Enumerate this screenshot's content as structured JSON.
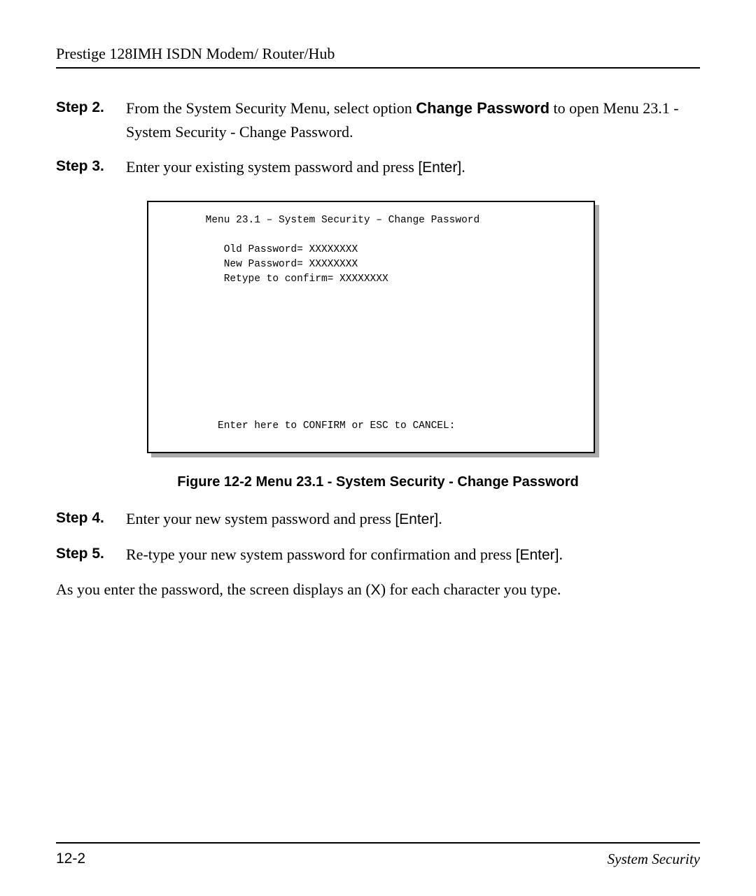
{
  "header": {
    "title": "Prestige 128IMH ISDN Modem/ Router/Hub"
  },
  "steps": [
    {
      "label": "Step 2.",
      "pre": "From the System Security Menu, select option ",
      "bold": "Change Password",
      "mid": " to open Menu 23.1 - System Security - Change Password.",
      "key": ""
    },
    {
      "label": "Step 3.",
      "pre": "Enter your existing system password and press ",
      "bold": "",
      "mid": "",
      "key": "[Enter]",
      "post": "."
    },
    {
      "label": "Step 4.",
      "pre": "Enter your new system password and press ",
      "bold": "",
      "mid": "",
      "key": "[Enter]",
      "post": "."
    },
    {
      "label": "Step 5.",
      "pre": "Re-type your new system password for confirmation and press ",
      "bold": "",
      "mid": "",
      "key": "[Enter]",
      "post": "."
    }
  ],
  "terminal": {
    "title": "        Menu 23.1 – System Security – Change Password",
    "line1": "           Old Password= XXXXXXXX",
    "line2": "           New Password= XXXXXXXX",
    "line3": "           Retype to confirm= XXXXXXXX",
    "footer": "          Enter here to CONFIRM or ESC to CANCEL:"
  },
  "figure_caption": "Figure 12-2 Menu 23.1 - System Security - Change Password",
  "body_para": {
    "pre": "As you enter the password, the screen displays an (",
    "key": "X",
    "post": ") for each character you type."
  },
  "footer": {
    "page": "12-2",
    "section": "System Security"
  }
}
